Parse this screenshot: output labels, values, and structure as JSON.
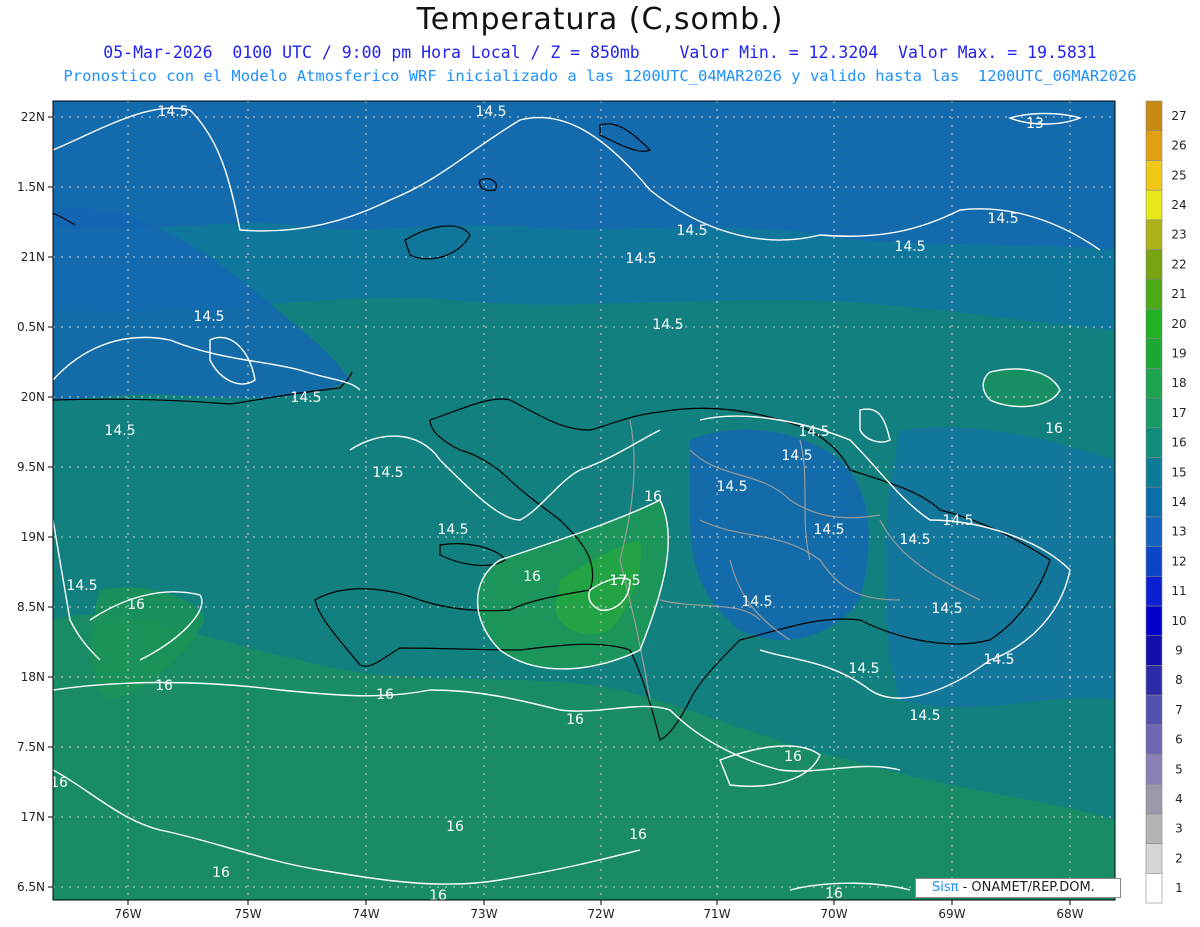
{
  "header": {
    "title": "Temperatura (C,somb.)",
    "line1": "05-Mar-2026  0100 UTC / 9:00 pm Hora Local / Z = 850mb    Valor Min. = 12.3204  Valor Max. = 19.5831",
    "line2": "Pronostico con el Modelo Atmosferico WRF inicializado a las 1200UTC_04MAR2026 y valido hasta las  1200UTC_06MAR2026"
  },
  "axes": {
    "lat_labels": [
      "22N",
      "1.5N",
      "21N",
      "0.5N",
      "20N",
      "9.5N",
      "19N",
      "8.5N",
      "18N",
      "7.5N",
      "17N",
      "6.5N"
    ],
    "lon_labels": [
      "76W",
      "75W",
      "74W",
      "73W",
      "72W",
      "71W",
      "70W",
      "69W",
      "68W"
    ]
  },
  "colorbar": {
    "levels": [
      "1",
      "2",
      "3",
      "4",
      "5",
      "6",
      "7",
      "8",
      "9",
      "10",
      "11",
      "12",
      "13",
      "14",
      "15",
      "16",
      "17",
      "18",
      "19",
      "20",
      "21",
      "22",
      "23",
      "24",
      "25",
      "26",
      "27"
    ],
    "colors": [
      "#ffffff",
      "#d6d6d6",
      "#b4b4b4",
      "#9a9aaa",
      "#8b7fb8",
      "#6e68b4",
      "#5450b0",
      "#2c2ca8",
      "#1010a8",
      "#0000c8",
      "#0a1ed2",
      "#0c46c8",
      "#1264be",
      "#0a6ea8",
      "#0c7c96",
      "#108c7c",
      "#169a64",
      "#1ea44e",
      "#1aa832",
      "#22b024",
      "#4aaa18",
      "#78a414",
      "#b0b018",
      "#e8e818",
      "#f0c818",
      "#e0a012",
      "#c88a10"
    ]
  },
  "contour_labels": [
    "14.5",
    "14.5",
    "14.5",
    "14.5",
    "14.5",
    "14.5",
    "14.5",
    "14.5",
    "14.5",
    "14.5",
    "14.5",
    "14.5",
    "14.5",
    "14.5",
    "14.5",
    "14.5",
    "14.5",
    "14.5",
    "14.5",
    "16",
    "16",
    "16",
    "16",
    "16",
    "16",
    "16",
    "16",
    "16",
    "16",
    "16",
    "16",
    "17.5",
    "13"
  ],
  "credit": {
    "logo": "Sisπ",
    "text": "- ONAMET/REP.DOM."
  }
}
